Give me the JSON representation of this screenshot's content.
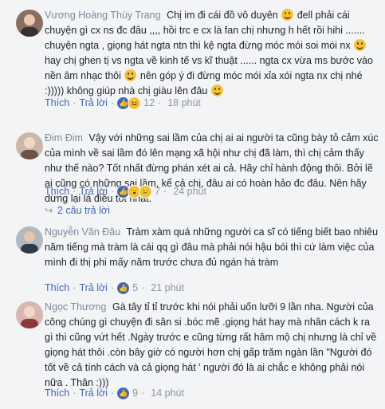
{
  "comments": [
    {
      "name": "Vương Hoàng Thùy Trang",
      "text_parts": [
        "Chị im đi cái đồ vô duyên ",
        " đell phải cái chuyện gì cx ns đc đâu ,,,, hồi trc e cx là fan chị nhưng h hết rồi hihi ....... chuyện ngta , giọng hát ngta ntn thì kệ ngta đừng móc mói soi mói nx ",
        " hay chị ghen tị vs ngta về kinh tế vs kĩ thuật ...... ngta cx vừa ms bước vào nền âm nhạc thôi ",
        " nên góp ý đi đừng móc mói xỉa xói ngta nx chị nhé :))))) không giúp nhà chị giàu lên đâu "
      ],
      "like_label": "Thích",
      "reply_label": "Trả lời",
      "reaction_icons": [
        "like-icon",
        "haha-icon"
      ],
      "reaction_count": "12",
      "time": "18 phút"
    },
    {
      "name": "Đim Đim",
      "text": "Vậy với những sai lầm của chị ai ai người ta cũng bày tỏ cảm xúc của mình về sai lầm đó lên mạng xã hội như chị đã làm, thì chị cảm thấy như thế nào? Tốt nhất đừng phán xét ai cả. Hãy chỉ hành động thôi. Bởi lẽ ai cũng có những sai lầm, kể cả chị, đâu ai có hoàn hảo đc đâu. Nên hãy dừng lại là điều tốt nhất.",
      "like_label": "Thích",
      "reply_label": "Trả lời",
      "reaction_icons": [
        "like-icon",
        "wow-icon",
        "sad-icon"
      ],
      "reaction_count": "7",
      "time": "24 phút",
      "replies_label": "2 câu trả lời"
    },
    {
      "name": "Nguyễn Văn Đâu",
      "text": "Tràm xàm quá những người ca sĩ có tiếng biết bao nhiêu năm tiếng mà tràm là cái qq gì đâu mà phải nói hậu bói thì cứ làm việc của mình đi thị phi mấy năm trước chưa đủ ngán hà tràm",
      "like_label": "Thích",
      "reply_label": "Trả lời",
      "reaction_icons": [
        "like-icon"
      ],
      "reaction_count": "5",
      "time": "21 phút"
    },
    {
      "name": "Ngọc Thương",
      "text": "Gà tây tỉ tỉ trước khi nói phải uốn lưỡi 9 lần nha. Người của công chúng gì chuyện đi sân si .bóc mẽ .giọng hát hay mà nhân cách k ra gì thì cũng vứt hết .Ngày trước e cũng từng rất hâm mộ chị nhưng là chỉ về giọng hát thôi .còn bây giờ có người hơn chị gấp trăm ngàn lần \"Người đó tốt về cả tính cách và cả giọng hát ' người đó là ai chắc e không phải nói nữa . Thân :)))",
      "like_label": "Thích",
      "reply_label": "Trả lời",
      "reaction_icons": [
        "like-icon"
      ],
      "reaction_count": "9",
      "time": "14 phút"
    }
  ]
}
